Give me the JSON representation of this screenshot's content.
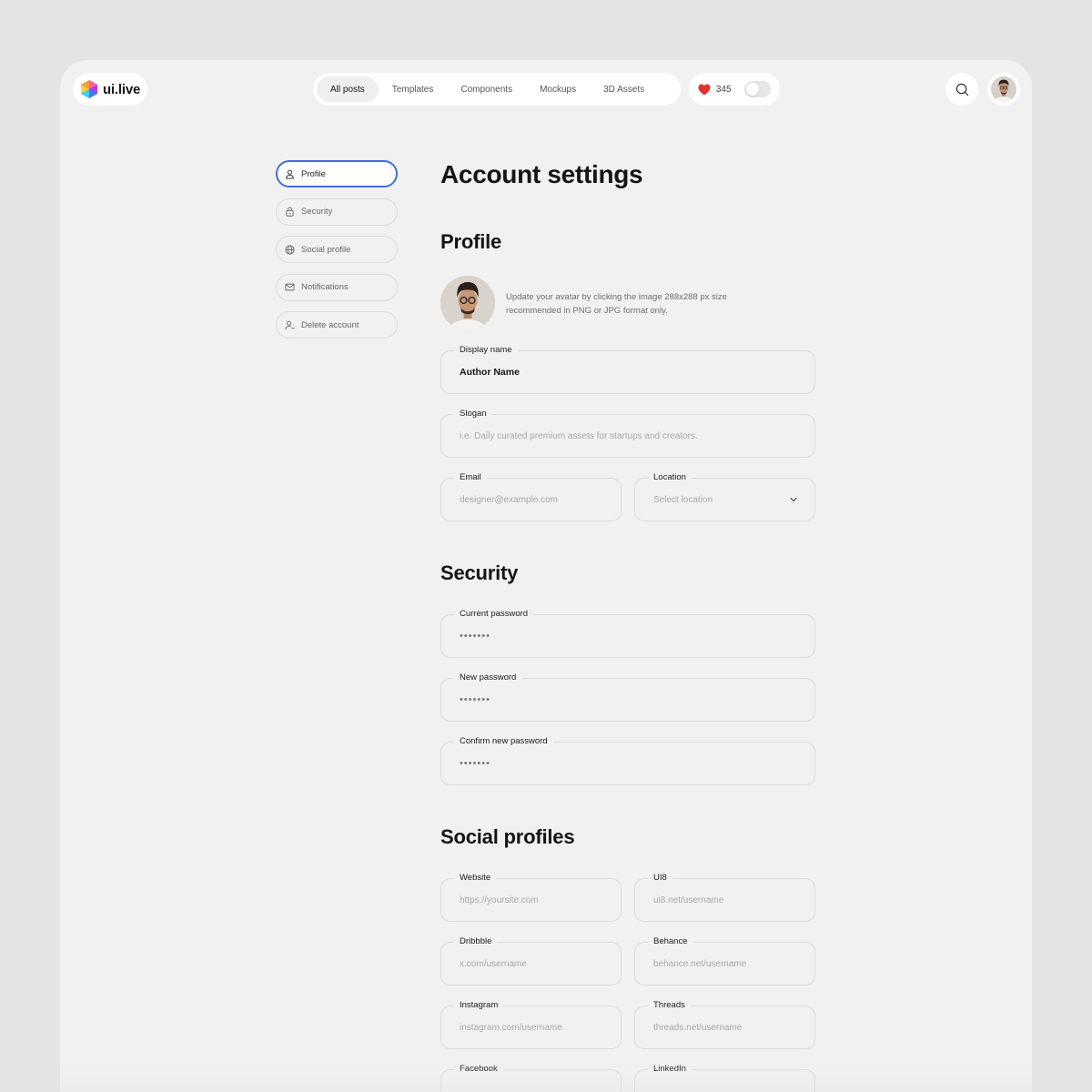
{
  "brand": {
    "name": "ui.live"
  },
  "nav": {
    "items": [
      {
        "label": "All posts",
        "active": true
      },
      {
        "label": "Templates",
        "active": false
      },
      {
        "label": "Components",
        "active": false
      },
      {
        "label": "Mockups",
        "active": false
      },
      {
        "label": "3D Assets",
        "active": false
      }
    ]
  },
  "likes": {
    "count": "345",
    "toggle_on": false
  },
  "side_menu": {
    "items": [
      {
        "label": "Profile",
        "icon": "user-icon",
        "active": true
      },
      {
        "label": "Security",
        "icon": "lock-icon",
        "active": false
      },
      {
        "label": "Social profile",
        "icon": "globe-icon",
        "active": false
      },
      {
        "label": "Notifications",
        "icon": "mail-icon",
        "active": false
      },
      {
        "label": "Delete account",
        "icon": "user-remove-icon",
        "active": false
      }
    ]
  },
  "page": {
    "title": "Account settings"
  },
  "profile": {
    "title": "Profile",
    "avatar_help": "Update your avatar by clicking the image 288x288 px size recommended in PNG or JPG format only.",
    "display_name": {
      "label": "Display name",
      "value": "Author Name"
    },
    "slogan": {
      "label": "Slogan",
      "placeholder": "i.e. Daily curated premium assets for startups and creators."
    },
    "email": {
      "label": "Email",
      "placeholder": "designer@example.com"
    },
    "location": {
      "label": "Location",
      "placeholder": "Select location"
    }
  },
  "security": {
    "title": "Security",
    "current_password": {
      "label": "Current password",
      "value": "•••••••"
    },
    "new_password": {
      "label": "New password",
      "value": "•••••••"
    },
    "confirm_password": {
      "label": "Confirm new password",
      "value": "•••••••"
    }
  },
  "social": {
    "title": "Social profiles",
    "website": {
      "label": "Website",
      "placeholder": "https://yoursite.com"
    },
    "ui8": {
      "label": "UI8",
      "placeholder": "ui8.net/username"
    },
    "dribbble": {
      "label": "Dribbble",
      "placeholder": "x.com/username"
    },
    "behance": {
      "label": "Behance",
      "placeholder": "behance.net/username"
    },
    "instagram": {
      "label": "Instagram",
      "placeholder": "instagram.com/username"
    },
    "threads": {
      "label": "Threads",
      "placeholder": "threads.net/username"
    },
    "facebook": {
      "label": "Facebook"
    },
    "linkedin": {
      "label": "LinkedIn"
    }
  },
  "colors": {
    "accent": "#3f6fd8",
    "heart": "#e5322d",
    "background": "#e4e4e4",
    "panel": "#f1f1f1"
  }
}
